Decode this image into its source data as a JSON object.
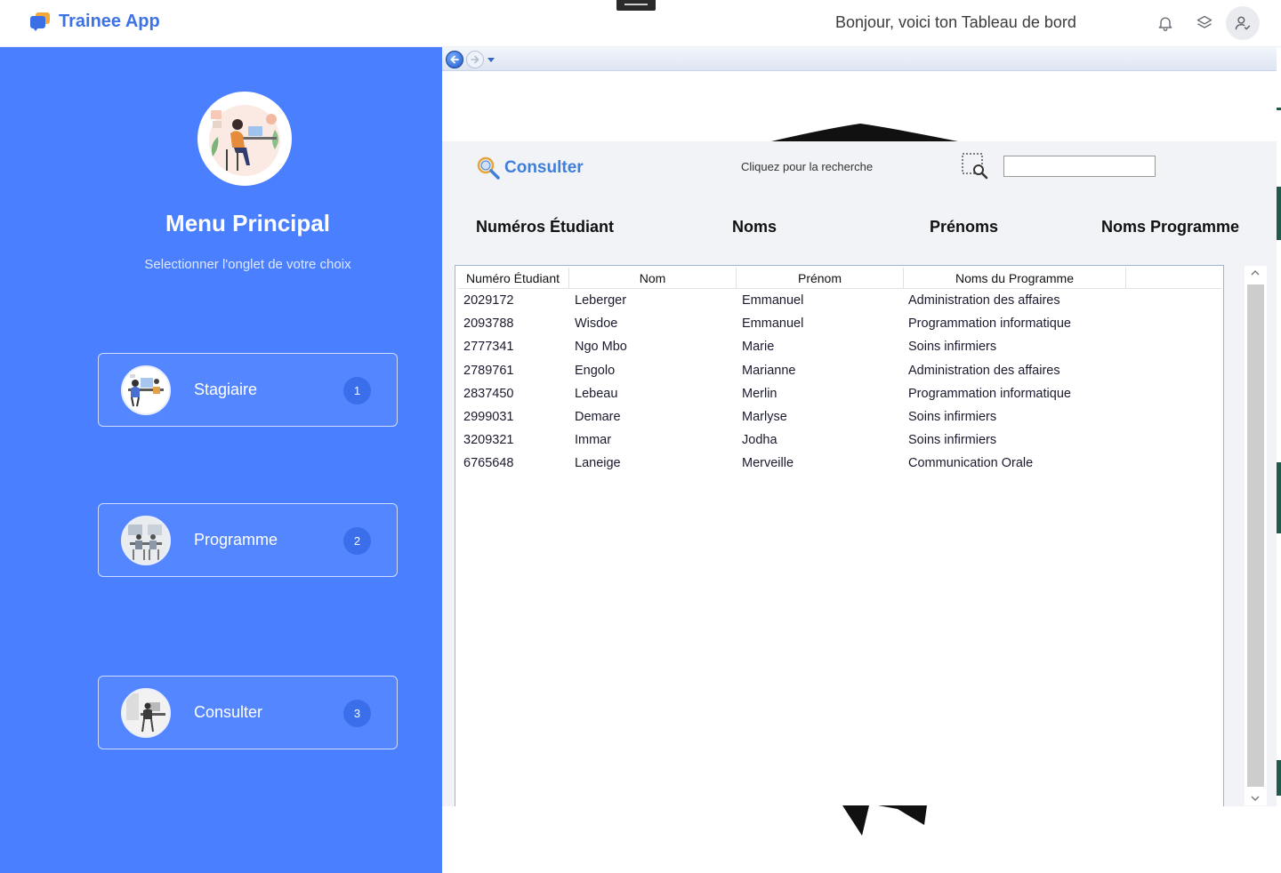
{
  "app": {
    "name": "Trainee App",
    "greeting": "Bonjour, voici ton Tableau de bord"
  },
  "topbar_icons": [
    "bell-icon",
    "layers-icon",
    "user-check-icon"
  ],
  "sidebar": {
    "title": "Menu Principal",
    "subtitle": "Selectionner l'onglet de votre choix",
    "items": [
      {
        "label": "Stagiaire",
        "badge": "1"
      },
      {
        "label": "Programme",
        "badge": "2"
      },
      {
        "label": "Consulter",
        "badge": "3"
      }
    ]
  },
  "consult": {
    "title": "Consulter",
    "search_hint": "Cliquez pour la recherche",
    "search_value": "",
    "column_headers": [
      "Numéros Étudiant",
      "Noms",
      "Prénoms",
      "Noms Programme"
    ]
  },
  "grid": {
    "headers": [
      "Numéro Étudiant",
      "Nom",
      "Prénom",
      "Noms du Programme"
    ],
    "rows": [
      [
        "2029172",
        "Leberger",
        "Emmanuel",
        "Administration des affaires"
      ],
      [
        "2093788",
        "Wisdoe",
        "Emmanuel",
        "Programmation informatique"
      ],
      [
        "2777341",
        "Ngo Mbo",
        "Marie",
        "Soins infirmiers"
      ],
      [
        "2789761",
        "Engolo",
        "Marianne",
        "Administration des affaires"
      ],
      [
        "2837450",
        "Lebeau",
        "Merlin",
        "Programmation informatique"
      ],
      [
        "2999031",
        "Demare",
        "Marlyse",
        "Soins infirmiers"
      ],
      [
        "3209321",
        "Immar",
        "Jodha",
        "Soins infirmiers"
      ],
      [
        "6765648",
        "Laneige",
        "Merveille",
        "Communication Orale"
      ]
    ]
  },
  "colors": {
    "sidebar_bg": "#4a80ff",
    "brand_blue": "#3d72e4",
    "logo_orange": "#f3a83a",
    "consult_title": "#3f7fd9",
    "badge_bg": "#3a6eea"
  }
}
